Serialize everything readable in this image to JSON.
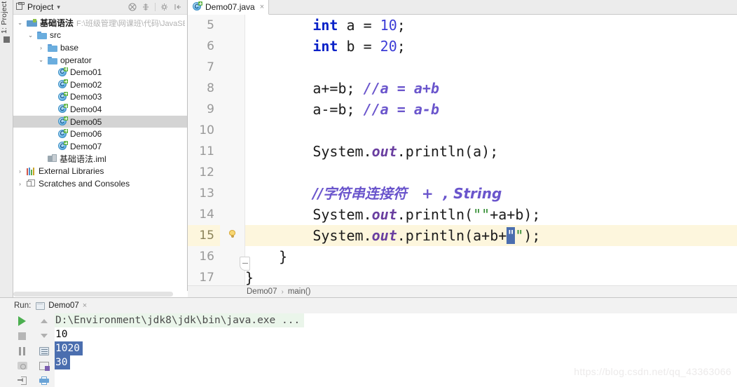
{
  "left_stripe": {
    "project_tab": "1: Project"
  },
  "project_panel": {
    "title": "Project",
    "caret": "▾",
    "header_icons": [
      "collapse-all-icon",
      "expand-icon",
      "settings-icon",
      "hide-icon"
    ],
    "tree": [
      {
        "depth": 0,
        "arrow": "⌄",
        "icon": "module-icon",
        "label": "基础语法",
        "bold": true,
        "path": "F:\\班级管理\\网课班\\代码\\JavaSE\\基础",
        "selected": false
      },
      {
        "depth": 1,
        "arrow": "⌄",
        "icon": "folder-icon",
        "label": "src",
        "bold": false,
        "path": "",
        "selected": false
      },
      {
        "depth": 2,
        "arrow": "›",
        "icon": "folder-icon",
        "label": "base",
        "bold": false,
        "path": "",
        "selected": false
      },
      {
        "depth": 2,
        "arrow": "⌄",
        "icon": "folder-icon",
        "label": "operator",
        "bold": false,
        "path": "",
        "selected": false
      },
      {
        "depth": 3,
        "arrow": "",
        "icon": "java-class-icon",
        "label": "Demo01",
        "bold": false,
        "path": "",
        "selected": false
      },
      {
        "depth": 3,
        "arrow": "",
        "icon": "java-class-icon",
        "label": "Demo02",
        "bold": false,
        "path": "",
        "selected": false
      },
      {
        "depth": 3,
        "arrow": "",
        "icon": "java-class-icon",
        "label": "Demo03",
        "bold": false,
        "path": "",
        "selected": false
      },
      {
        "depth": 3,
        "arrow": "",
        "icon": "java-class-icon",
        "label": "Demo04",
        "bold": false,
        "path": "",
        "selected": false
      },
      {
        "depth": 3,
        "arrow": "",
        "icon": "java-class-icon",
        "label": "Demo05",
        "bold": false,
        "path": "",
        "selected": true
      },
      {
        "depth": 3,
        "arrow": "",
        "icon": "java-class-icon",
        "label": "Demo06",
        "bold": false,
        "path": "",
        "selected": false
      },
      {
        "depth": 3,
        "arrow": "",
        "icon": "java-class-icon",
        "label": "Demo07",
        "bold": false,
        "path": "",
        "selected": false
      },
      {
        "depth": 2,
        "arrow": "",
        "icon": "iml-file-icon",
        "label": "基础语法.iml",
        "bold": false,
        "path": "",
        "selected": false
      },
      {
        "depth": 0,
        "arrow": "›",
        "icon": "external-libraries-icon",
        "label": "External Libraries",
        "bold": false,
        "path": "",
        "selected": false
      },
      {
        "depth": 0,
        "arrow": "›",
        "icon": "scratches-icon",
        "label": "Scratches and Consoles",
        "bold": false,
        "path": "",
        "selected": false
      }
    ]
  },
  "editor": {
    "tab": {
      "label": "Demo07.java",
      "icon": "java-class-icon",
      "close": "×"
    },
    "line_numbers": [
      "5",
      "6",
      "7",
      "8",
      "9",
      "10",
      "11",
      "12",
      "13",
      "14",
      "15",
      "16",
      "17"
    ],
    "current_line": "15",
    "gutter_bulb_line": "15",
    "lines": [
      {
        "n": "5",
        "text": "        int a = 10;"
      },
      {
        "n": "6",
        "text": "        int b = 20;"
      },
      {
        "n": "7",
        "text": ""
      },
      {
        "n": "8",
        "text": "        a+=b; //a = a+b"
      },
      {
        "n": "9",
        "text": "        a-=b; //a = a-b"
      },
      {
        "n": "10",
        "text": ""
      },
      {
        "n": "11",
        "text": "        System.out.println(a);"
      },
      {
        "n": "12",
        "text": ""
      },
      {
        "n": "13",
        "text": "        //字符串连接符   +  , String"
      },
      {
        "n": "14",
        "text": "        System.out.println(\"\"+a+b);"
      },
      {
        "n": "15",
        "text": "        System.out.println(a+b+\"\");"
      },
      {
        "n": "16",
        "text": "    }"
      },
      {
        "n": "17",
        "text": "}"
      }
    ],
    "breadcrumb": {
      "class": "Demo07",
      "separator": "›",
      "method": "main()"
    }
  },
  "run_window": {
    "label": "Run:",
    "tab": {
      "label": "Demo07",
      "close": "×"
    },
    "toolbar_left": [
      "rerun-icon",
      "stop-icon",
      "pause-icon",
      "camera-icon",
      "exit-icon"
    ],
    "toolbar_right": [
      "scroll-up-icon",
      "scroll-down-icon",
      "soft-wrap-icon",
      "export-icon",
      "print-icon"
    ],
    "console": {
      "command": "D:\\Environment\\jdk8\\jdk\\bin\\java.exe ...",
      "output": [
        "10",
        "1020",
        "30"
      ],
      "selected_output": [
        "1020",
        "30"
      ]
    }
  },
  "watermark": "https://blog.csdn.net/qq_43363066"
}
